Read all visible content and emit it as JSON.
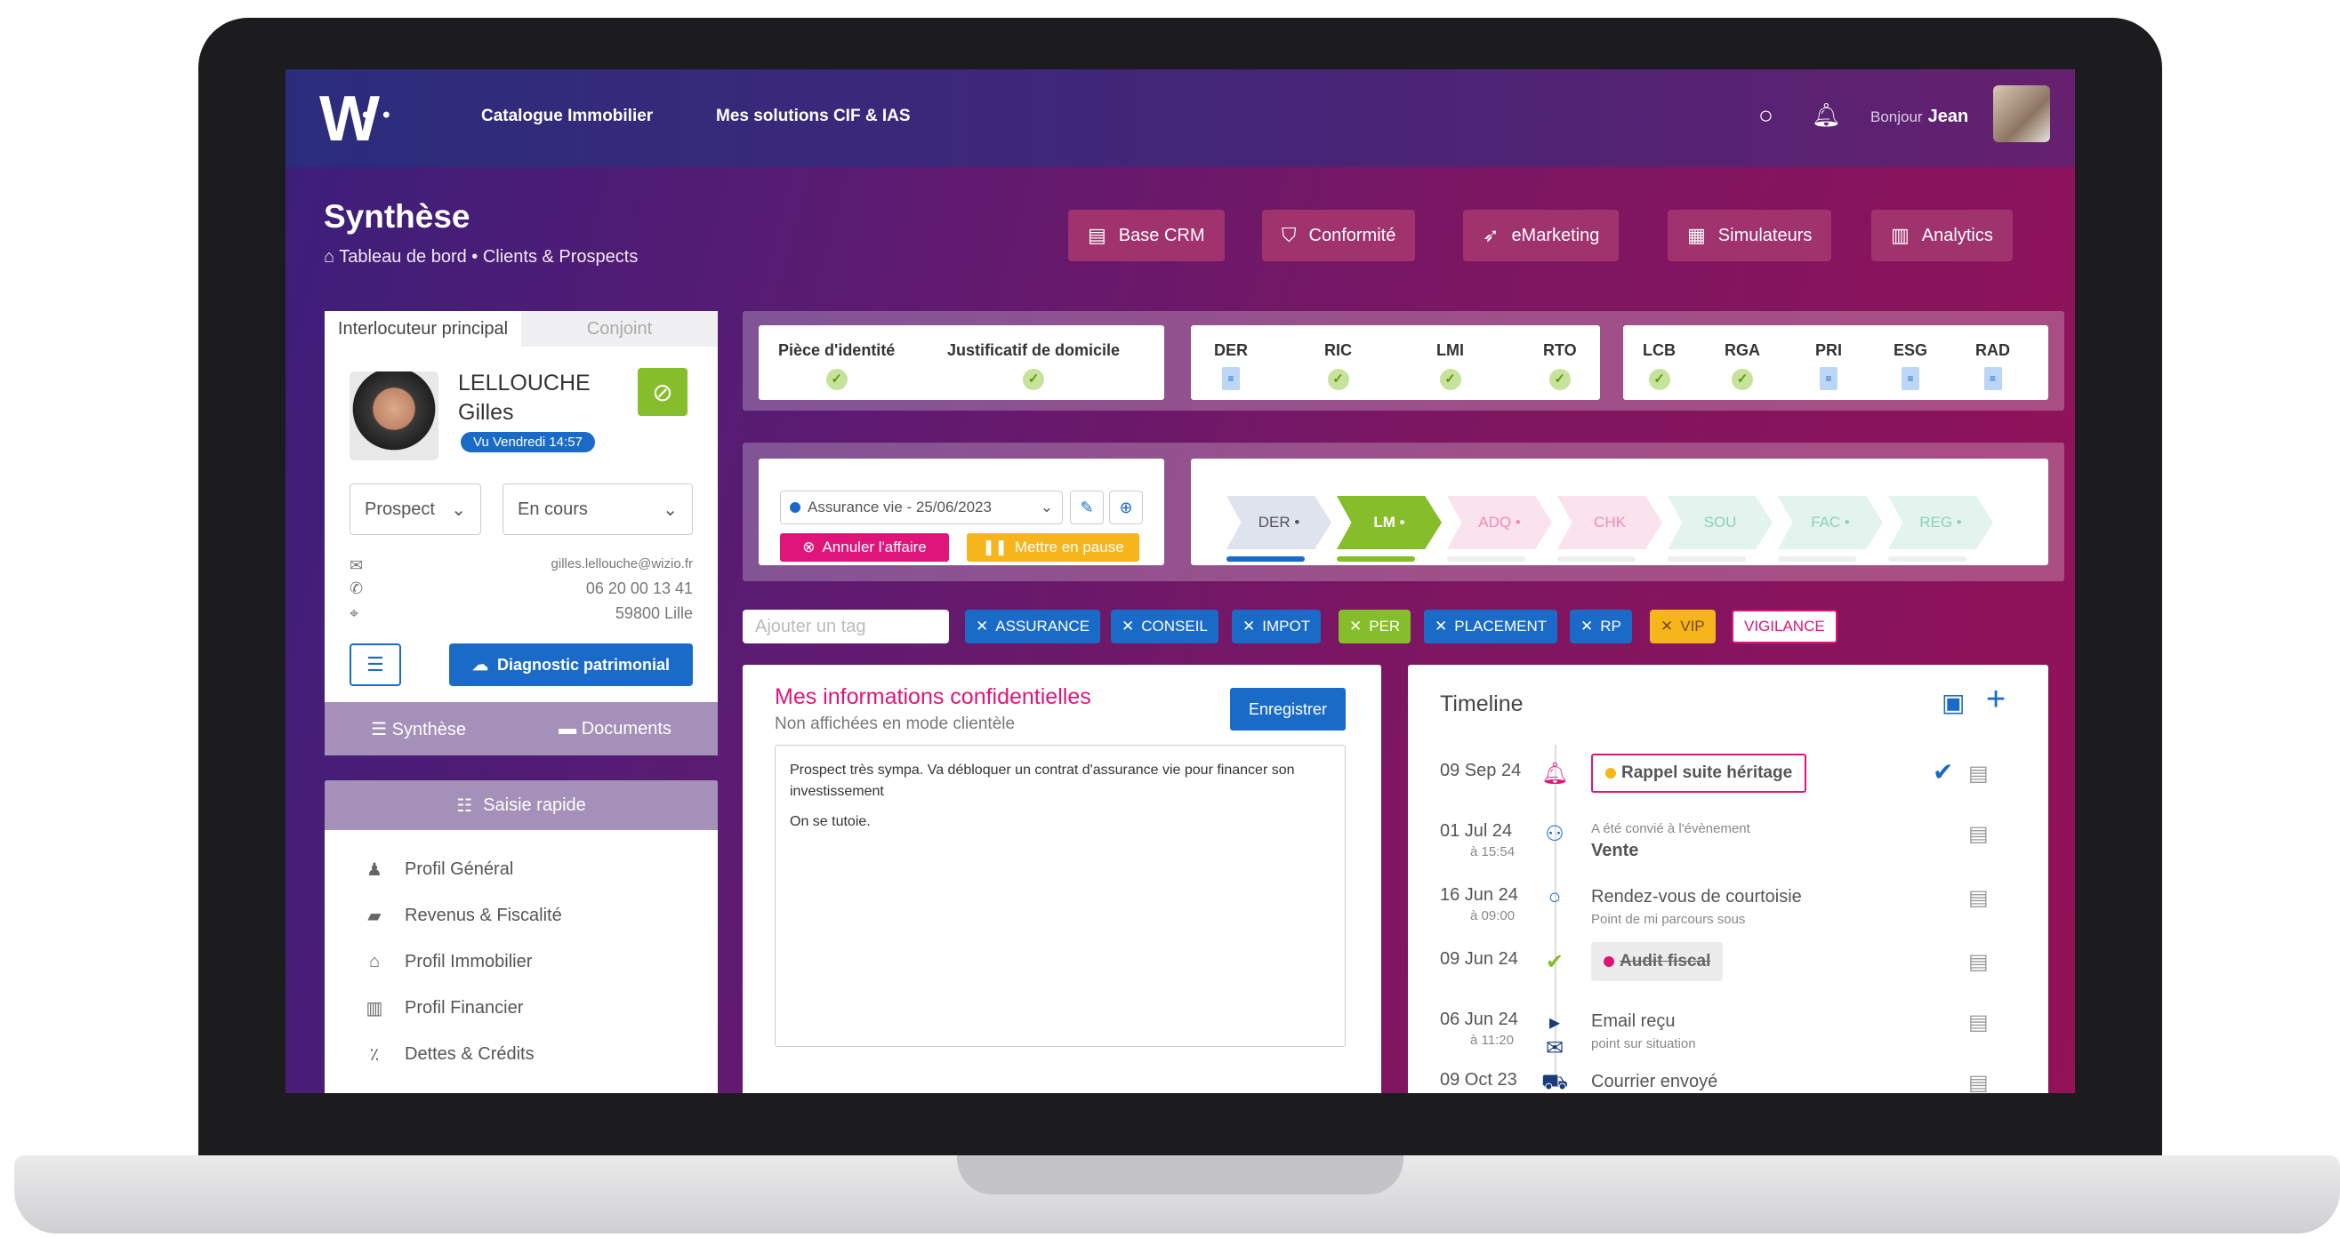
{
  "topbar": {
    "logo": "W",
    "nav1": "Catalogue Immobilier",
    "nav2": "Mes solutions CIF & IAS",
    "greeting": "Bonjour",
    "user": "Jean"
  },
  "page": {
    "title": "Synthèse",
    "breadcrumb": "Tableau de bord • Clients & Prospects"
  },
  "modules": [
    "Base CRM",
    "Conformité",
    "eMarketing",
    "Simulateurs",
    "Analytics"
  ],
  "contact": {
    "tab_main": "Interlocuteur principal",
    "tab_spouse": "Conjoint",
    "last_name": "LELLOUCHE",
    "first_name": "Gilles",
    "seen": "Vu Vendredi 14:57",
    "status": "Prospect",
    "stage": "En cours",
    "email": "gilles.lellouche@wizio.fr",
    "phone": "06 20 00 13 41",
    "city": "59800 Lille",
    "diag": "Diagnostic patrimonial",
    "tab1": "Synthèse",
    "tab2": "Documents"
  },
  "quick": {
    "header": "Saisie rapide",
    "items": [
      "Profil Général",
      "Revenus & Fiscalité",
      "Profil Immobilier",
      "Profil Financier",
      "Dettes & Crédits"
    ]
  },
  "docs": {
    "group1": [
      "Pièce d'identité",
      "Justificatif de domicile"
    ],
    "group2": [
      "DER",
      "RIC",
      "LMI",
      "RTO"
    ],
    "group3": [
      "LCB",
      "RGA",
      "PRI",
      "ESG",
      "RAD"
    ]
  },
  "affaire": {
    "selected": "Assurance vie - 25/06/2023",
    "cancel": "Annuler l'affaire",
    "pause": "Mettre en pause"
  },
  "steps": [
    "DER",
    "LM",
    "ADQ",
    "CHK",
    "SOU",
    "FAC",
    "REG"
  ],
  "tags": {
    "placeholder": "Ajouter un tag",
    "items": [
      "ASSURANCE",
      "CONSEIL",
      "IMPOT",
      "PER",
      "PLACEMENT",
      "RP",
      "VIP",
      "VIGILANCE"
    ]
  },
  "conf": {
    "title": "Mes informations confidentielles",
    "subtitle": "Non affichées en mode clientèle",
    "save": "Enregistrer",
    "note1": "Prospect très sympa.  Va débloquer un contrat d'assurance vie pour financer son investissement",
    "note2": "On se tutoie."
  },
  "timeline": {
    "title": "Timeline",
    "rows": [
      {
        "date": "09 Sep 24",
        "time": "",
        "text": "Rappel suite héritage",
        "sub": ""
      },
      {
        "date": "01 Jul 24",
        "time": "à 15:54",
        "text": "Vente",
        "sub": "A été convié à l'évènement"
      },
      {
        "date": "16 Jun 24",
        "time": "à 09:00",
        "text": "Rendez-vous de courtoisie",
        "sub": "Point de mi parcours sous"
      },
      {
        "date": "09 Jun 24",
        "time": "",
        "text": "Audit fiscal",
        "sub": ""
      },
      {
        "date": "06 Jun 24",
        "time": "à 11:20",
        "text": "Email reçu",
        "sub": "point sur situation"
      },
      {
        "date": "09 Oct 23",
        "time": "",
        "text": "Courrier envoyé",
        "sub": ""
      }
    ]
  },
  "colors": {
    "blue": "#1a6bc7",
    "green": "#86bd2a",
    "pink": "#e0157a",
    "yellow": "#f7b51c"
  }
}
